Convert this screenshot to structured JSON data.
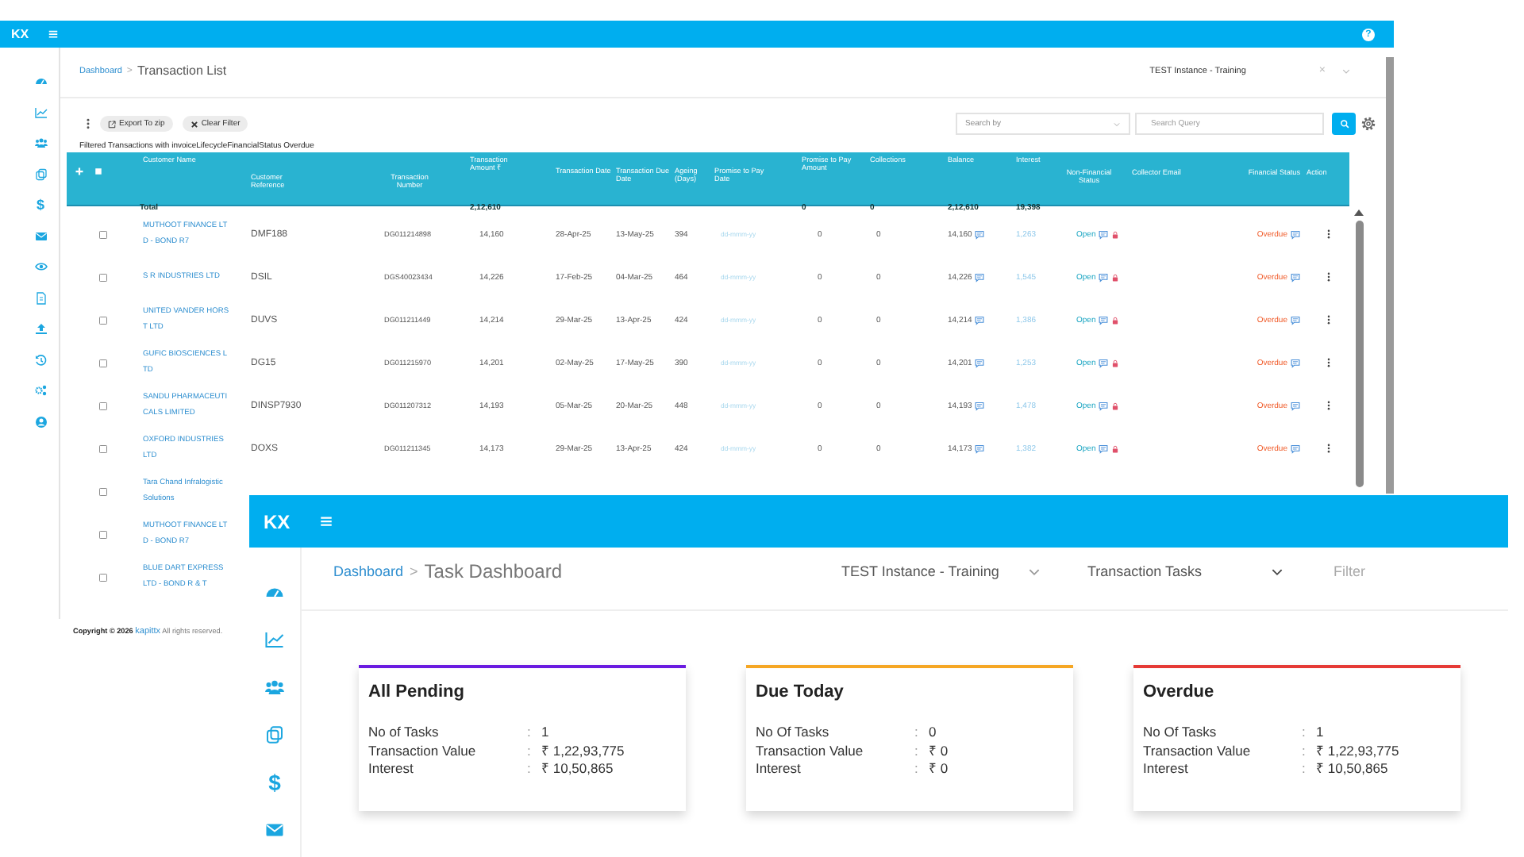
{
  "back_window": {
    "logo": "KX",
    "help": "?",
    "sidebar_symbol": "$",
    "breadcrumb": {
      "parent": "Dashboard",
      "separator": ">",
      "current": "Transaction List"
    },
    "instance": {
      "value": "TEST Instance - Training",
      "clear": "×"
    },
    "toolbar": {
      "buttons": [
        "Export To zip",
        "Clear Filter"
      ],
      "search_by": {
        "placeholder": "Search by"
      },
      "search_query": {
        "placeholder": "Search Query"
      }
    },
    "filter_note": "Filtered Transactions with invoiceLifecycleFinancialStatus Overdue",
    "table": {
      "select_all": {
        "checked": false
      },
      "columns": [
        "Customer Name",
        "Customer Reference",
        "Transaction Number",
        "Transaction Amount ₹",
        "Transaction Date",
        "Transaction Due Date",
        "Ageing (Days)",
        "Promise to Pay Date",
        "Promise to Pay Amount",
        "Collections",
        "Balance",
        "Interest",
        "Non-Financial Status",
        "Collector Email",
        "Financial Status",
        "Action"
      ],
      "totals": {
        "label": "Total",
        "amount": "2,12,610",
        "promise_amount": "0",
        "collections": "0",
        "balance": "2,12,610",
        "interest": "19,398"
      },
      "rows": [
        {
          "checked": false,
          "customer_name": "MUTHOOT FINANCE LTD - BOND R7",
          "customer_reference": "DMF188",
          "transaction_number": "DG011214898",
          "amount": "14,160",
          "transaction_date": "28-Apr-25",
          "due_date": "13-May-25",
          "ageing": "394",
          "promise_date": "dd-mmm-yy",
          "promise_amount": "0",
          "collections": "0",
          "balance": "14,160",
          "interest": "1,263",
          "non_financial_status": "Open",
          "financial_status": "Overdue"
        },
        {
          "checked": false,
          "customer_name": "S R INDUSTRIES LTD",
          "customer_reference": "DSIL",
          "transaction_number": "DGS40023434",
          "amount": "14,226",
          "transaction_date": "17-Feb-25",
          "due_date": "04-Mar-25",
          "ageing": "464",
          "promise_date": "dd-mmm-yy",
          "promise_amount": "0",
          "collections": "0",
          "balance": "14,226",
          "interest": "1,545",
          "non_financial_status": "Open",
          "financial_status": "Overdue"
        },
        {
          "checked": false,
          "customer_name": "UNITED VANDER HORST LTD",
          "customer_reference": "DUVS",
          "transaction_number": "DG011211449",
          "amount": "14,214",
          "transaction_date": "29-Mar-25",
          "due_date": "13-Apr-25",
          "ageing": "424",
          "promise_date": "dd-mmm-yy",
          "promise_amount": "0",
          "collections": "0",
          "balance": "14,214",
          "interest": "1,386",
          "non_financial_status": "Open",
          "financial_status": "Overdue"
        },
        {
          "checked": false,
          "customer_name": "GUFIC BIOSCIENCES LTD",
          "customer_reference": "DG15",
          "transaction_number": "DG011215970",
          "amount": "14,201",
          "transaction_date": "02-May-25",
          "due_date": "17-May-25",
          "ageing": "390",
          "promise_date": "dd-mmm-yy",
          "promise_amount": "0",
          "collections": "0",
          "balance": "14,201",
          "interest": "1,253",
          "non_financial_status": "Open",
          "financial_status": "Overdue"
        },
        {
          "checked": false,
          "customer_name": "SANDU PHARMACEUTICALS LIMITED",
          "customer_reference": "DINSP7930",
          "transaction_number": "DG011207312",
          "amount": "14,193",
          "transaction_date": "05-Mar-25",
          "due_date": "20-Mar-25",
          "ageing": "448",
          "promise_date": "dd-mmm-yy",
          "promise_amount": "0",
          "collections": "0",
          "balance": "14,193",
          "interest": "1,478",
          "non_financial_status": "Open",
          "financial_status": "Overdue"
        },
        {
          "checked": false,
          "customer_name": "OXFORD INDUSTRIES LTD",
          "customer_reference": "DOXS",
          "transaction_number": "DG011211345",
          "amount": "14,173",
          "transaction_date": "29-Mar-25",
          "due_date": "13-Apr-25",
          "ageing": "424",
          "promise_date": "dd-mmm-yy",
          "promise_amount": "0",
          "collections": "0",
          "balance": "14,173",
          "interest": "1,382",
          "non_financial_status": "Open",
          "financial_status": "Overdue"
        },
        {
          "checked": false,
          "customer_name": "Tara Chand Infralogistic Solutions"
        },
        {
          "checked": false,
          "customer_name": "MUTHOOT FINANCE LTD - BOND R7"
        },
        {
          "checked": false,
          "customer_name": "BLUE DART EXPRESS LTD - BOND R & T"
        }
      ]
    },
    "copyright": {
      "before": "Copyright © 2026",
      "link": "kapittx",
      "after": "All rights reserved."
    }
  },
  "front_window": {
    "logo": "KX",
    "sidebar_symbol": "$",
    "breadcrumb": {
      "parent": "Dashboard",
      "separator": ">",
      "current": "Task Dashboard"
    },
    "selectors": [
      "TEST Instance - Training",
      "Transaction Tasks"
    ],
    "filter": {
      "placeholder": "Filter"
    },
    "cards": [
      {
        "title": "All Pending",
        "color": "#6a1be0",
        "rows": [
          {
            "label": "No of Tasks",
            "colon": ":",
            "value": "1"
          },
          {
            "label": "Transaction Value",
            "colon": ":",
            "value": "₹ 1,22,93,775"
          },
          {
            "label": "Interest",
            "colon": ":",
            "value": "₹ 10,50,865"
          }
        ]
      },
      {
        "title": "Due Today",
        "color": "#f5a623",
        "rows": [
          {
            "label": "No Of Tasks",
            "colon": ":",
            "value": "0"
          },
          {
            "label": "Transaction Value",
            "colon": ":",
            "value": "₹ 0"
          },
          {
            "label": "Interest",
            "colon": ":",
            "value": "₹ 0"
          }
        ]
      },
      {
        "title": "Overdue",
        "color": "#e53935",
        "rows": [
          {
            "label": "No Of Tasks",
            "colon": ":",
            "value": "1"
          },
          {
            "label": "Transaction Value",
            "colon": ":",
            "value": "₹ 1,22,93,775"
          },
          {
            "label": "Interest",
            "colon": ":",
            "value": "₹ 10,50,865"
          }
        ]
      }
    ]
  }
}
